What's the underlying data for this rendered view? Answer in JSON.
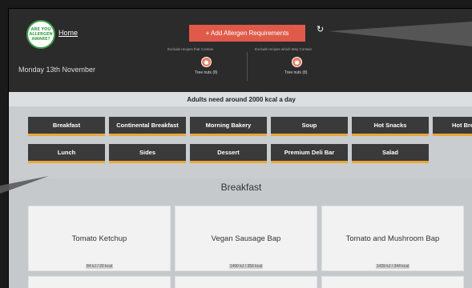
{
  "logo": {
    "text": "ARE YOU ALLERGEN AWARE?"
  },
  "header": {
    "home_label": "Home",
    "add_button_label": "+ Add Allergen Requirements",
    "refresh_icon": "refresh-icon",
    "exclude_contain_label": "Exclude recipes that Contain",
    "exclude_may_label": "Exclude recipes which May Contain",
    "nut_contain_label": "Tree nuts (8)",
    "nut_may_label": "Tree nuts (8)",
    "date": "Monday 13th November"
  },
  "kcal_note": "Adults need around 2000 kcal a day",
  "categories": [
    "Breakfast",
    "Continental Breakfast",
    "Morning Bakery",
    "Soup",
    "Hot Snacks",
    "Hot Breads",
    "Lunch",
    "Sides",
    "Dessert",
    "Premium Deli Bar",
    "Salad"
  ],
  "section": {
    "title": "Breakfast",
    "cards": [
      {
        "name": "Tomato Ketchup",
        "energy": "84 kJ / 20 kcal"
      },
      {
        "name": "Vegan Sausage Bap",
        "energy": "1490 kJ / 356 kcal"
      },
      {
        "name": "Tomato and Mushroom Bap",
        "energy": "1439 kJ / 344 kcal"
      }
    ]
  },
  "colors": {
    "header_bg": "#2b2b2b",
    "accent_red": "#e05a4a",
    "category_underline": "#e8a83a",
    "nut_icon": "#e87c5c"
  }
}
